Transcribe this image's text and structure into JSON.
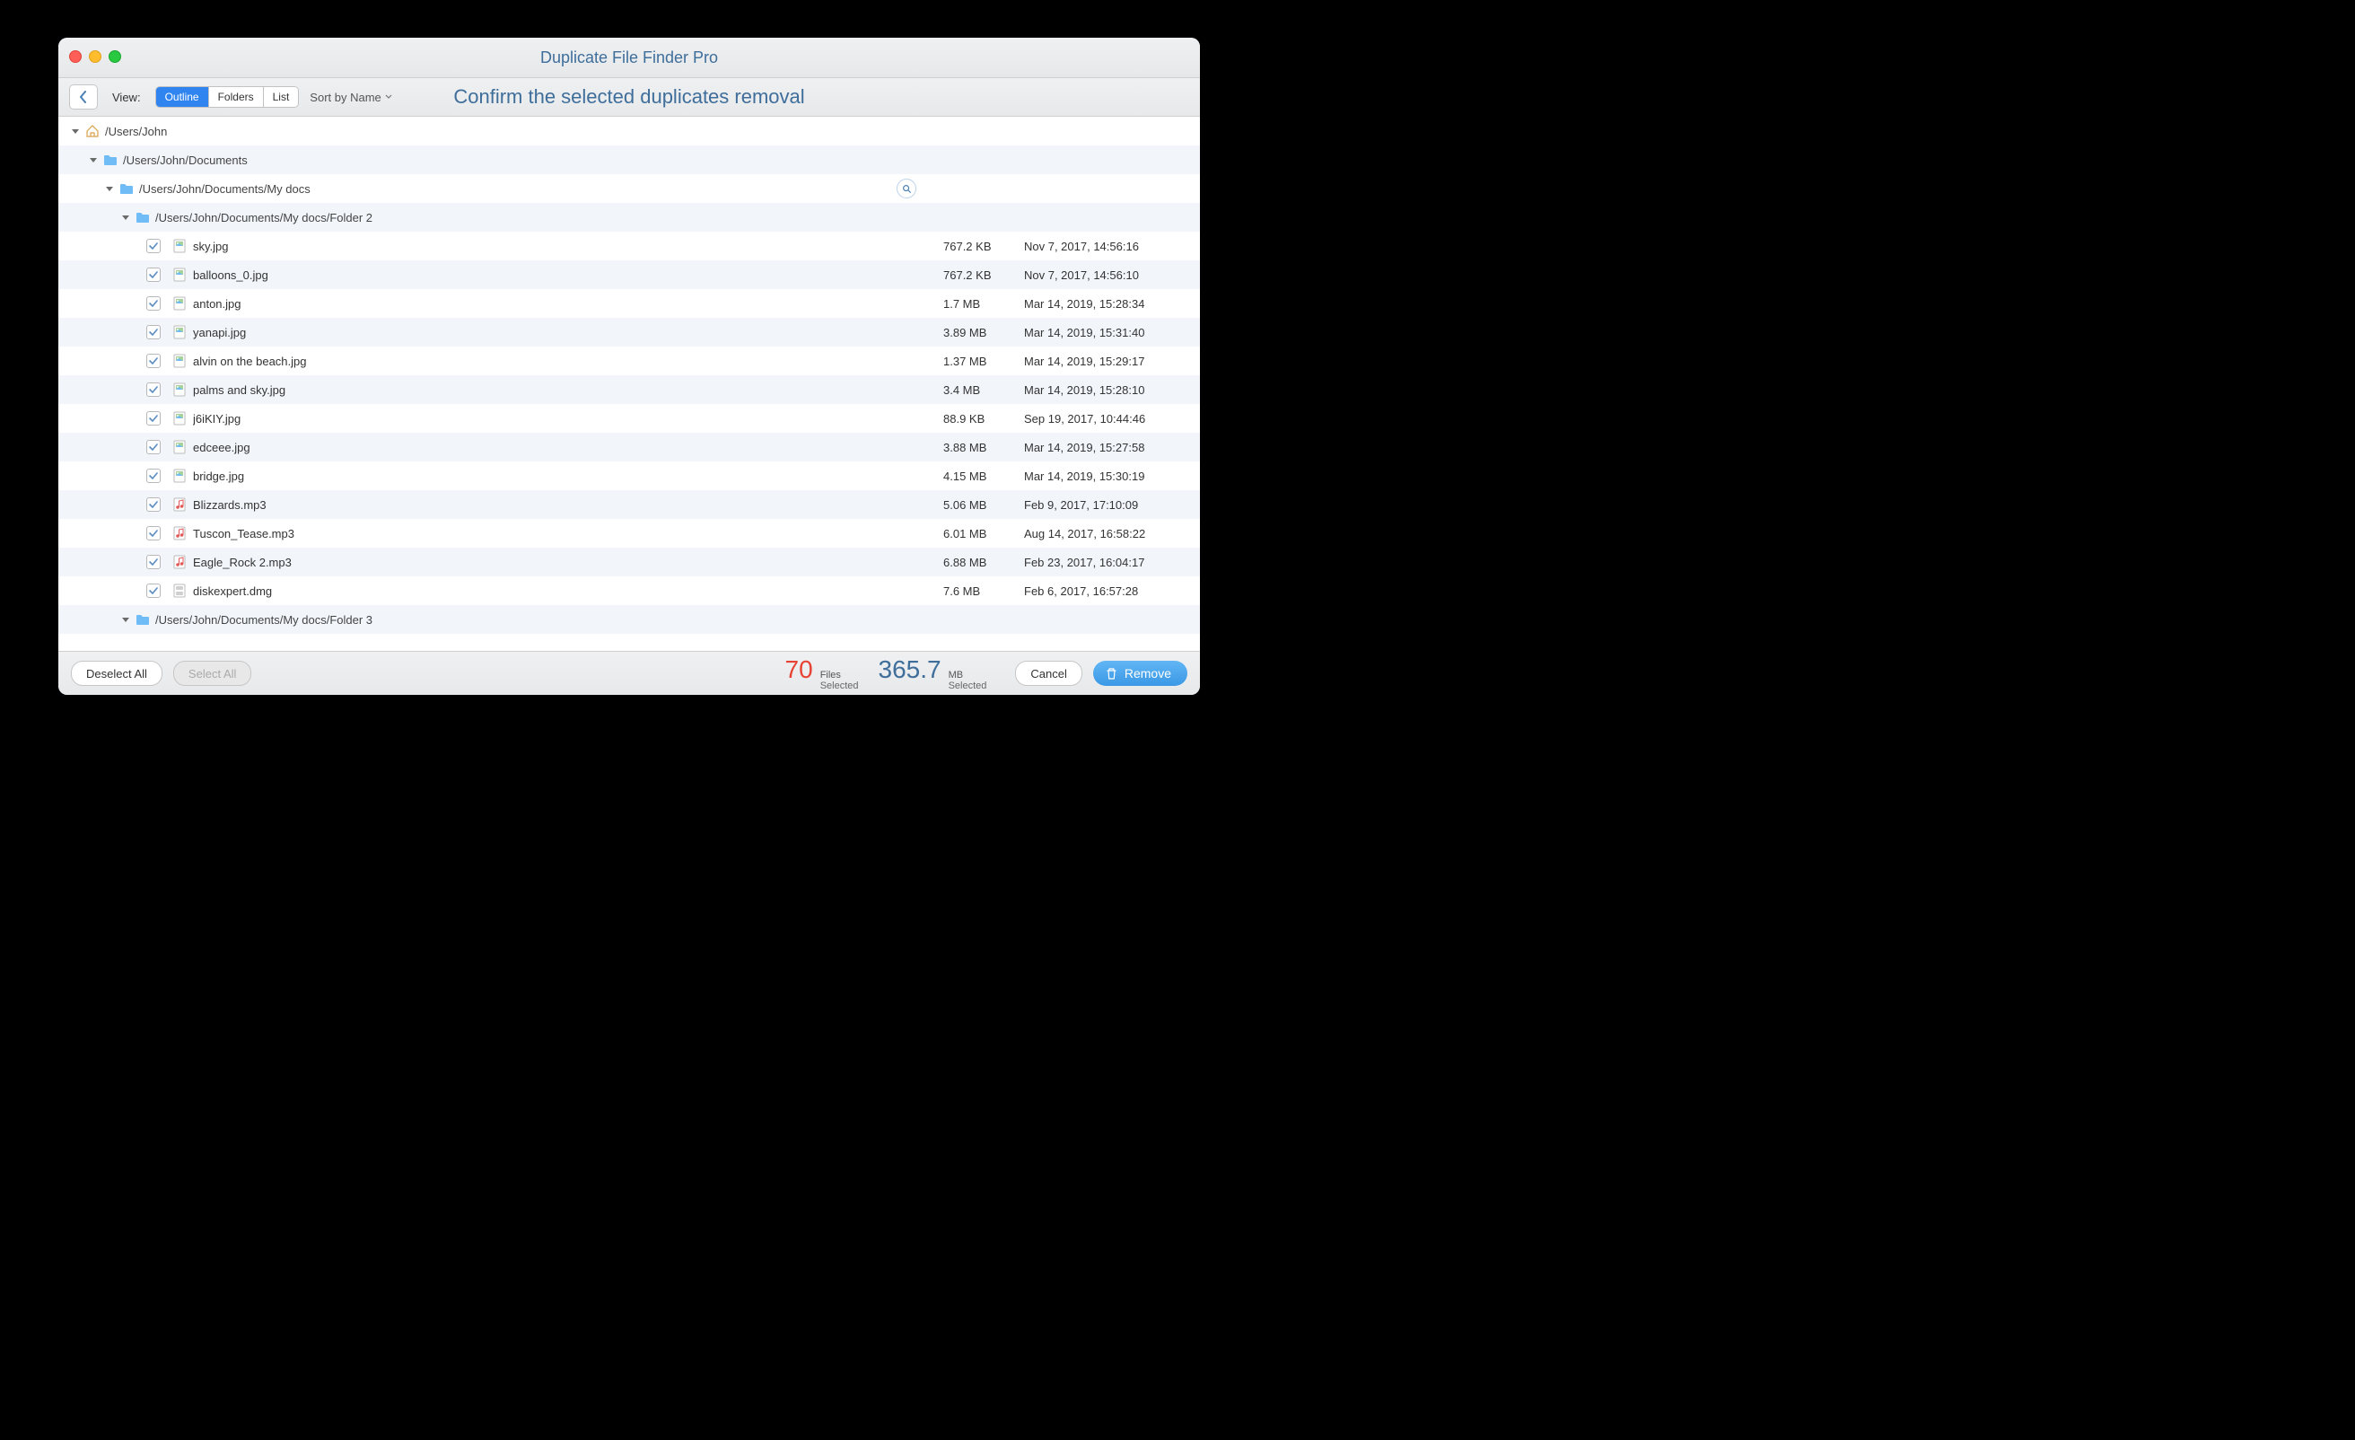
{
  "window": {
    "title": "Duplicate File Finder Pro"
  },
  "toolbar": {
    "view_label": "View:",
    "tabs": {
      "outline": "Outline",
      "folders": "Folders",
      "list": "List"
    },
    "sort_label": "Sort by Name",
    "heading": "Confirm the selected duplicates removal"
  },
  "tree": {
    "root_path": "/Users/John",
    "folders": [
      {
        "path": "/Users/John/Documents"
      },
      {
        "path": "/Users/John/Documents/My docs",
        "has_search": true
      },
      {
        "path": "/Users/John/Documents/My docs/Folder 2"
      }
    ],
    "files": [
      {
        "name": "sky.jpg",
        "size": "767.2 KB",
        "date": "Nov 7, 2017, 14:56:16",
        "type": "image"
      },
      {
        "name": "balloons_0.jpg",
        "size": "767.2 KB",
        "date": "Nov 7, 2017, 14:56:10",
        "type": "image"
      },
      {
        "name": "anton.jpg",
        "size": "1.7 MB",
        "date": "Mar 14, 2019, 15:28:34",
        "type": "image"
      },
      {
        "name": "yanapi.jpg",
        "size": "3.89 MB",
        "date": "Mar 14, 2019, 15:31:40",
        "type": "image"
      },
      {
        "name": "alvin on the beach.jpg",
        "size": "1.37 MB",
        "date": "Mar 14, 2019, 15:29:17",
        "type": "image"
      },
      {
        "name": "palms and sky.jpg",
        "size": "3.4 MB",
        "date": "Mar 14, 2019, 15:28:10",
        "type": "image"
      },
      {
        "name": "j6iKIY.jpg",
        "size": "88.9 KB",
        "date": "Sep 19, 2017, 10:44:46",
        "type": "image"
      },
      {
        "name": "edceee.jpg",
        "size": "3.88 MB",
        "date": "Mar 14, 2019, 15:27:58",
        "type": "image"
      },
      {
        "name": "bridge.jpg",
        "size": "4.15 MB",
        "date": "Mar 14, 2019, 15:30:19",
        "type": "image"
      },
      {
        "name": "Blizzards.mp3",
        "size": "5.06 MB",
        "date": "Feb 9, 2017, 17:10:09",
        "type": "audio"
      },
      {
        "name": "Tuscon_Tease.mp3",
        "size": "6.01 MB",
        "date": "Aug 14, 2017, 16:58:22",
        "type": "audio"
      },
      {
        "name": "Eagle_Rock 2.mp3",
        "size": "6.88 MB",
        "date": "Feb 23, 2017, 16:04:17",
        "type": "audio"
      },
      {
        "name": "diskexpert.dmg",
        "size": "7.6 MB",
        "date": "Feb 6, 2017, 16:57:28",
        "type": "disk"
      }
    ],
    "folder_after": {
      "path": "/Users/John/Documents/My docs/Folder 3"
    }
  },
  "footer": {
    "deselect": "Deselect All",
    "select": "Select All",
    "files_count": "70",
    "files_label_top": "Files",
    "files_label_bot": "Selected",
    "size_value": "365.7",
    "size_label_top": "MB",
    "size_label_bot": "Selected",
    "cancel": "Cancel",
    "remove": "Remove"
  }
}
